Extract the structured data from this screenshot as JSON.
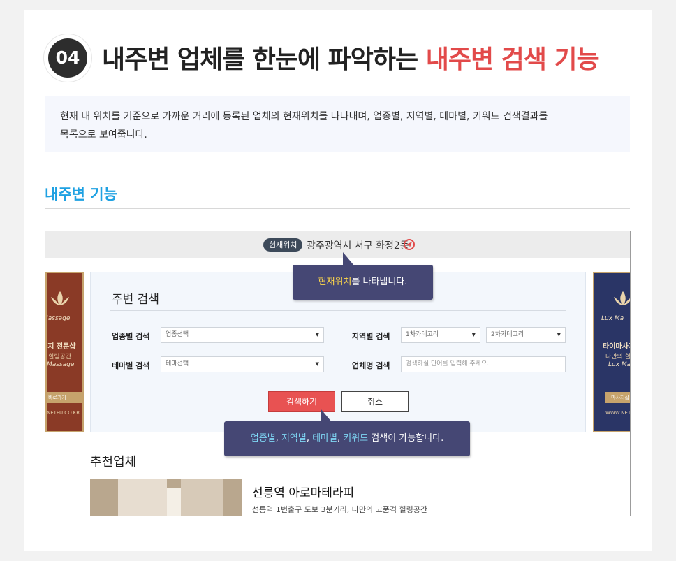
{
  "header": {
    "step_number": "04",
    "headline_main": "내주변 업체를 한눈에 파악하는",
    "headline_accent": "내주변 검색 기능",
    "accent_color": "#e24a4a"
  },
  "description": {
    "line1": "현재 내 위치를 기준으로 가까운 거리에 등록된 업체의 현재위치를 나타내며, 업종별, 지역별, 테마별, 키워드 검색결과를",
    "line2": "목록으로 보여줍니다."
  },
  "section": {
    "title": "내주변 기능",
    "title_color": "#1fa1e2"
  },
  "screenshot": {
    "location_bar": {
      "pill_label": "현재위치",
      "address": "광주광역시 서구 화정2동",
      "icon": "location-target-icon"
    },
    "banner_left": {
      "script": "Massage",
      "title": "사지 전문샵",
      "subtitle": "힐링공간",
      "eng": "Massage",
      "button": "바로가기",
      "url": "NETFU.CO.KR"
    },
    "banner_right": {
      "script": "Lux Ma",
      "title": "타이마사지",
      "subtitle": "나만의 힐",
      "eng": "Lux Ma",
      "button": "마사지샵 바로가기",
      "url": "WWW.NETFU"
    },
    "search_panel": {
      "title": "주변 검색",
      "business_label": "업종별 검색",
      "business_select": "업종선택",
      "region_label": "지역별 검색",
      "region_select_1": "1차카테고리",
      "region_select_2": "2차카테고리",
      "theme_label": "테마별 검색",
      "theme_select": "테마선택",
      "name_label": "업체명 검색",
      "name_placeholder": "검색하실 단어를 입력해 주세요.",
      "search_button": "검색하기",
      "cancel_button": "취소"
    },
    "tooltip_location": {
      "highlight": "현재위치",
      "rest": "를  나타냅니다."
    },
    "tooltip_search": {
      "part1": "업종별",
      "sep1": ", ",
      "part2": "지역별",
      "sep2": ", ",
      "part3": "테마별",
      "sep3": ", ",
      "part4": "키워드",
      "rest": " 검색이 가능합니다."
    },
    "recommend": {
      "title": "추천업체",
      "item_name": "선릉역 아로마테라피",
      "item_desc": "선릉역 1번출구 도보 3분거리, 나만의 고품격 힐링공간"
    }
  }
}
